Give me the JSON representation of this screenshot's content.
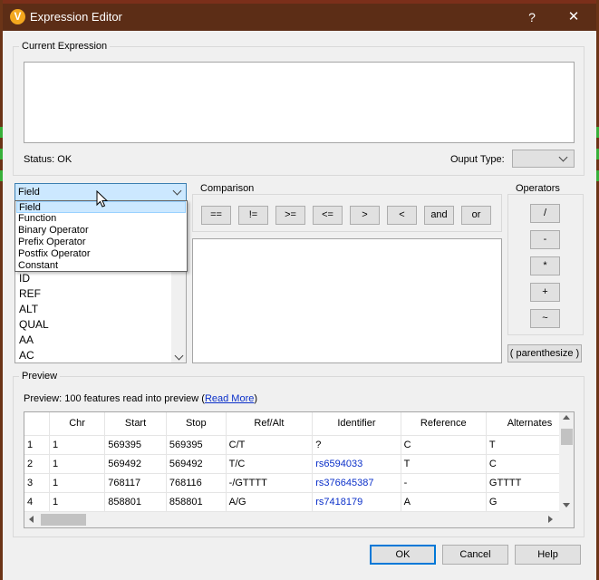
{
  "window": {
    "title": "Expression Editor",
    "icon_letter": "V",
    "help_glyph": "?",
    "close_glyph": "✕"
  },
  "current_expression": {
    "group_title": "Current Expression",
    "value": "",
    "status": "Status: OK",
    "output_type_label": "Ouput Type:",
    "output_type_value": ""
  },
  "field_panel": {
    "selected": "Field",
    "dropdown_options": [
      "Field",
      "Function",
      "Binary Operator",
      "Prefix Operator",
      "Postfix Operator",
      "Constant"
    ],
    "fields": [
      "ID",
      "REF",
      "ALT",
      "QUAL",
      "AA",
      "AC"
    ]
  },
  "comparison": {
    "group_title": "Comparison",
    "buttons": [
      "==",
      "!=",
      ">=",
      "<=",
      ">",
      "<",
      "and",
      "or"
    ]
  },
  "operators": {
    "group_title": "Operators",
    "buttons": [
      "/",
      "-",
      "*",
      "+",
      "~"
    ],
    "parenthesize": "( parenthesize )"
  },
  "preview": {
    "group_title": "Preview",
    "info_prefix": "Preview: 100 features read into preview (",
    "read_more": "Read More",
    "info_suffix": ")",
    "columns": [
      "",
      "Chr",
      "Start",
      "Stop",
      "Ref/Alt",
      "Identifier",
      "Reference",
      "Alternates"
    ],
    "rows": [
      {
        "n": "1",
        "chr": "1",
        "start": "569395",
        "stop": "569395",
        "refalt": "C/T",
        "id": "?",
        "id_link": false,
        "ref": "C",
        "alt": "T"
      },
      {
        "n": "2",
        "chr": "1",
        "start": "569492",
        "stop": "569492",
        "refalt": "T/C",
        "id": "rs6594033",
        "id_link": true,
        "ref": "T",
        "alt": "C"
      },
      {
        "n": "3",
        "chr": "1",
        "start": "768117",
        "stop": "768116",
        "refalt": "-/GTTTT",
        "id": "rs376645387",
        "id_link": true,
        "ref": "-",
        "alt": "GTTTT"
      },
      {
        "n": "4",
        "chr": "1",
        "start": "858801",
        "stop": "858801",
        "refalt": "A/G",
        "id": "rs7418179",
        "id_link": true,
        "ref": "A",
        "alt": "G"
      }
    ]
  },
  "footer": {
    "ok": "OK",
    "cancel": "Cancel",
    "help": "Help"
  }
}
